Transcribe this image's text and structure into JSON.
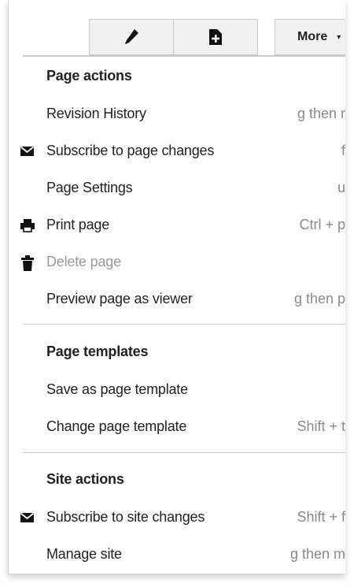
{
  "toolbar": {
    "edit_icon": "pencil-icon",
    "new_page_icon": "new-page-icon",
    "more_label": "More",
    "more_caret": "▾"
  },
  "sections": {
    "page_actions": {
      "heading": "Page actions",
      "items": [
        {
          "label": "Revision History",
          "shortcut": "g then r",
          "icon": null,
          "disabled": false
        },
        {
          "label": "Subscribe to page changes",
          "shortcut": "f",
          "icon": "envelope-icon",
          "disabled": false
        },
        {
          "label": "Page Settings",
          "shortcut": "u",
          "icon": null,
          "disabled": false
        },
        {
          "label": "Print page",
          "shortcut": "Ctrl + p",
          "icon": "printer-icon",
          "disabled": false
        },
        {
          "label": "Delete page",
          "shortcut": "",
          "icon": "trash-icon",
          "disabled": true
        },
        {
          "label": "Preview page as viewer",
          "shortcut": "g then p",
          "icon": null,
          "disabled": false
        }
      ]
    },
    "page_templates": {
      "heading": "Page templates",
      "items": [
        {
          "label": "Save as page template",
          "shortcut": "",
          "icon": null,
          "disabled": false
        },
        {
          "label": "Change page template",
          "shortcut": "Shift + t",
          "icon": null,
          "disabled": false
        }
      ]
    },
    "site_actions": {
      "heading": "Site actions",
      "items": [
        {
          "label": "Subscribe to site changes",
          "shortcut": "Shift + f",
          "icon": "envelope-icon",
          "disabled": false
        },
        {
          "label": "Manage site",
          "shortcut": "g then m",
          "icon": null,
          "disabled": false
        }
      ]
    }
  },
  "colors": {
    "text": "#222222",
    "shortcut": "#8a8a8a",
    "disabled": "#9a9a9a",
    "toolbar_bg": "#f1f1f1"
  }
}
